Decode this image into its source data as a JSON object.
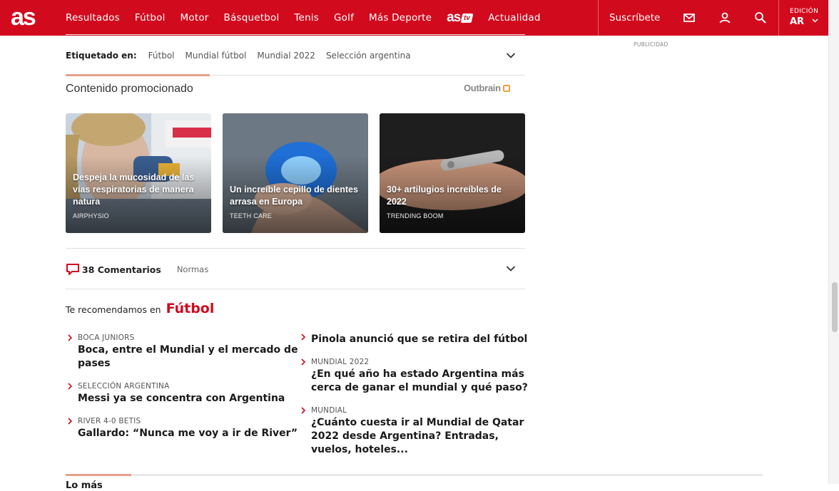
{
  "header": {
    "logo_text": "as",
    "nav": [
      "Resultados",
      "Fútbol",
      "Motor",
      "Básquetbol",
      "Tenis",
      "Golf",
      "Más Deporte"
    ],
    "astv": {
      "as": "as",
      "tv": "tv"
    },
    "nav_after": "Actualidad",
    "subscribe": "Suscríbete",
    "icons": [
      "mail-icon",
      "user-icon",
      "search-icon"
    ],
    "edition_label": "EDICIÓN",
    "edition_code": "AR",
    "brand_color": "#d20a1e"
  },
  "ad": {
    "label": "PUBLICIDAD"
  },
  "tags": {
    "label": "Etiquetado en:",
    "items": [
      "Fútbol",
      "Mundial fútbol",
      "Mundial 2022",
      "Selección argentina"
    ]
  },
  "promoted": {
    "title": "Contenido promocionado",
    "provider": "Outbrain",
    "cards": [
      {
        "title": "Despeja la mucosidad de las vías respiratorias de manera natura",
        "source": "AIRPHYSIO"
      },
      {
        "title": "Un increíble cepillo de dientes arrasa en Europa",
        "source": "TEETH CARE"
      },
      {
        "title": "30+ artilugios increíbles de 2022",
        "source": "TRENDING BOOM"
      }
    ]
  },
  "comments": {
    "count_label": "38 Comentarios",
    "rules": "Normas"
  },
  "recommended": {
    "prefix": "Te recomendamos en",
    "section": "Fútbol",
    "left": [
      {
        "kicker": "BOCA JUNIORS",
        "title": "Boca, entre el Mundial y el mercado de pases"
      },
      {
        "kicker": "SELECCIÓN ARGENTINA",
        "title": "Messi ya se concentra con Argentina"
      },
      {
        "kicker": "RIVER 4-0 BETIS",
        "title": "Gallardo: “Nunca me voy a ir de River”"
      }
    ],
    "right": [
      {
        "kicker": "",
        "title": "Pinola anunció que se retira del fútbol"
      },
      {
        "kicker": "MUNDIAL 2022",
        "title": "¿En qué año ha estado Argentina más cerca de ganar el mundial y qué paso?"
      },
      {
        "kicker": "MUNDIAL",
        "title": "¿Cuánto cuesta ir al Mundial de Qatar 2022 desde Argentina? Entradas, vuelos, hoteles..."
      }
    ]
  },
  "bottom_peek": "Lo más"
}
